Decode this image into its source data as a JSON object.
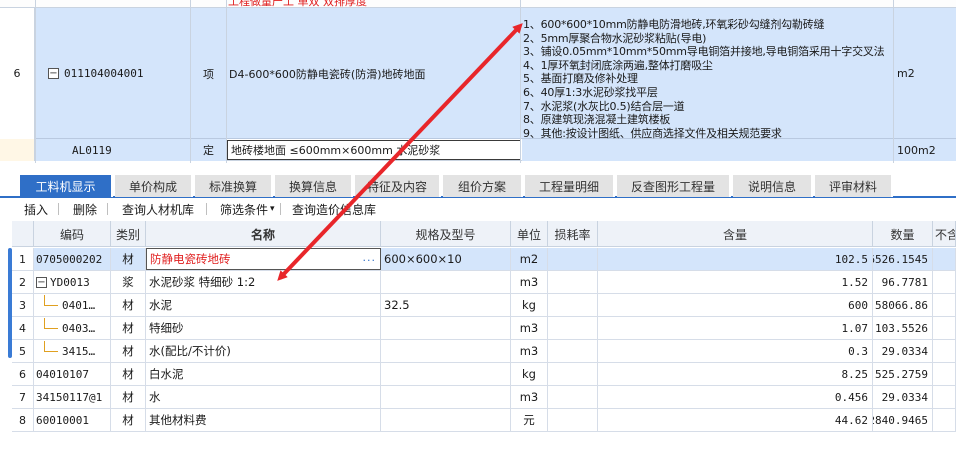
{
  "top_grid": {
    "prev_row_text": "工程做量产工 单双 双排厚度",
    "row6": {
      "index": "6",
      "code": "011104004001",
      "type": "项",
      "name": "D4-600*600防静电瓷砖(防滑)地砖地面",
      "features": [
        "1、600*600*10mm防静电防滑地砖,环氧彩砂勾缝剂勾勒砖缝",
        "2、5mm厚聚合物水泥砂浆粘贴(导电)",
        "3、铺设0.05mm*10mm*50mm导电铜箔并接地,导电铜箔采用十字交叉法",
        "4、1厚环氧封闭底涂两遍,整体打磨吸尘",
        "5、基面打磨及修补处理",
        "6、40厚1:3水泥砂浆找平层",
        "7、水泥浆(水灰比0.5)结合层一道",
        "8、原建筑现浇混凝土建筑楼板",
        "9、其他:按设计图纸、供应商选择文件及相关规范要求"
      ],
      "unit": "m2"
    },
    "row7": {
      "code": "AL0119",
      "type": "定",
      "name": "地砖楼地面 ≤600mm×600mm 水泥砂浆",
      "unit": "100m2"
    }
  },
  "tabs": [
    {
      "label": "工料机显示",
      "active": true
    },
    {
      "label": "单价构成",
      "active": false
    },
    {
      "label": "标准换算",
      "active": false
    },
    {
      "label": "换算信息",
      "active": false
    },
    {
      "label": "特征及内容",
      "active": false
    },
    {
      "label": "组价方案",
      "active": false
    },
    {
      "label": "工程量明细",
      "active": false
    },
    {
      "label": "反查图形工程量",
      "active": false
    },
    {
      "label": "说明信息",
      "active": false
    },
    {
      "label": "评审材料",
      "active": false
    }
  ],
  "toolbar": {
    "insert": "插入",
    "delete": "删除",
    "query_labor": "查询人材机库",
    "filter": "筛选条件",
    "filter_arrow": "▾",
    "query_price": "查询造价信息库"
  },
  "bottom_grid": {
    "headers": [
      "编码",
      "类别",
      "名称",
      "规格及型号",
      "单位",
      "损耗率",
      "含量",
      "数量",
      "不含"
    ],
    "rows": [
      {
        "idx": "1",
        "code": "0705000202",
        "type": "材",
        "name": "防静电瓷砖地砖",
        "spec": "600×600×10",
        "unit": "m2",
        "loss": "",
        "content": "102.5",
        "qty": "6526.1545",
        "tree": "none"
      },
      {
        "idx": "2",
        "code": "YD0013",
        "type": "浆",
        "name": "水泥砂浆 特细砂 1:2",
        "spec": "",
        "unit": "m3",
        "loss": "",
        "content": "1.52",
        "qty": "96.7781",
        "tree": "parent"
      },
      {
        "idx": "3",
        "code": "0401…",
        "type": "材",
        "name": "水泥",
        "spec": "32.5",
        "unit": "kg",
        "loss": "",
        "content": "600",
        "qty": "58066.86",
        "tree": "child"
      },
      {
        "idx": "4",
        "code": "0403…",
        "type": "材",
        "name": "特细砂",
        "spec": "",
        "unit": "m3",
        "loss": "",
        "content": "1.07",
        "qty": "103.5526",
        "tree": "child"
      },
      {
        "idx": "5",
        "code": "3415…",
        "type": "材",
        "name": "水(配比/不计价)",
        "spec": "",
        "unit": "m3",
        "loss": "",
        "content": "0.3",
        "qty": "29.0334",
        "tree": "last"
      },
      {
        "idx": "6",
        "code": "04010107",
        "type": "材",
        "name": "白水泥",
        "spec": "",
        "unit": "kg",
        "loss": "",
        "content": "8.25",
        "qty": "525.2759",
        "tree": "none"
      },
      {
        "idx": "7",
        "code": "34150117@1",
        "type": "材",
        "name": "水",
        "spec": "",
        "unit": "m3",
        "loss": "",
        "content": "0.456",
        "qty": "29.0334",
        "tree": "none"
      },
      {
        "idx": "8",
        "code": "60010001",
        "type": "材",
        "name": "其他材料费",
        "spec": "",
        "unit": "元",
        "loss": "",
        "content": "44.62",
        "qty": "2840.9465",
        "tree": "none"
      }
    ],
    "ellipsis": "···"
  },
  "icons": {
    "collapse": "−",
    "annotation_arrow": "double-headed-red-arrow"
  },
  "colors": {
    "accent": "#2f6fc7",
    "selection": "#d4e5fb",
    "arrow": "#e8262a",
    "highlight_text": "#e02020"
  }
}
